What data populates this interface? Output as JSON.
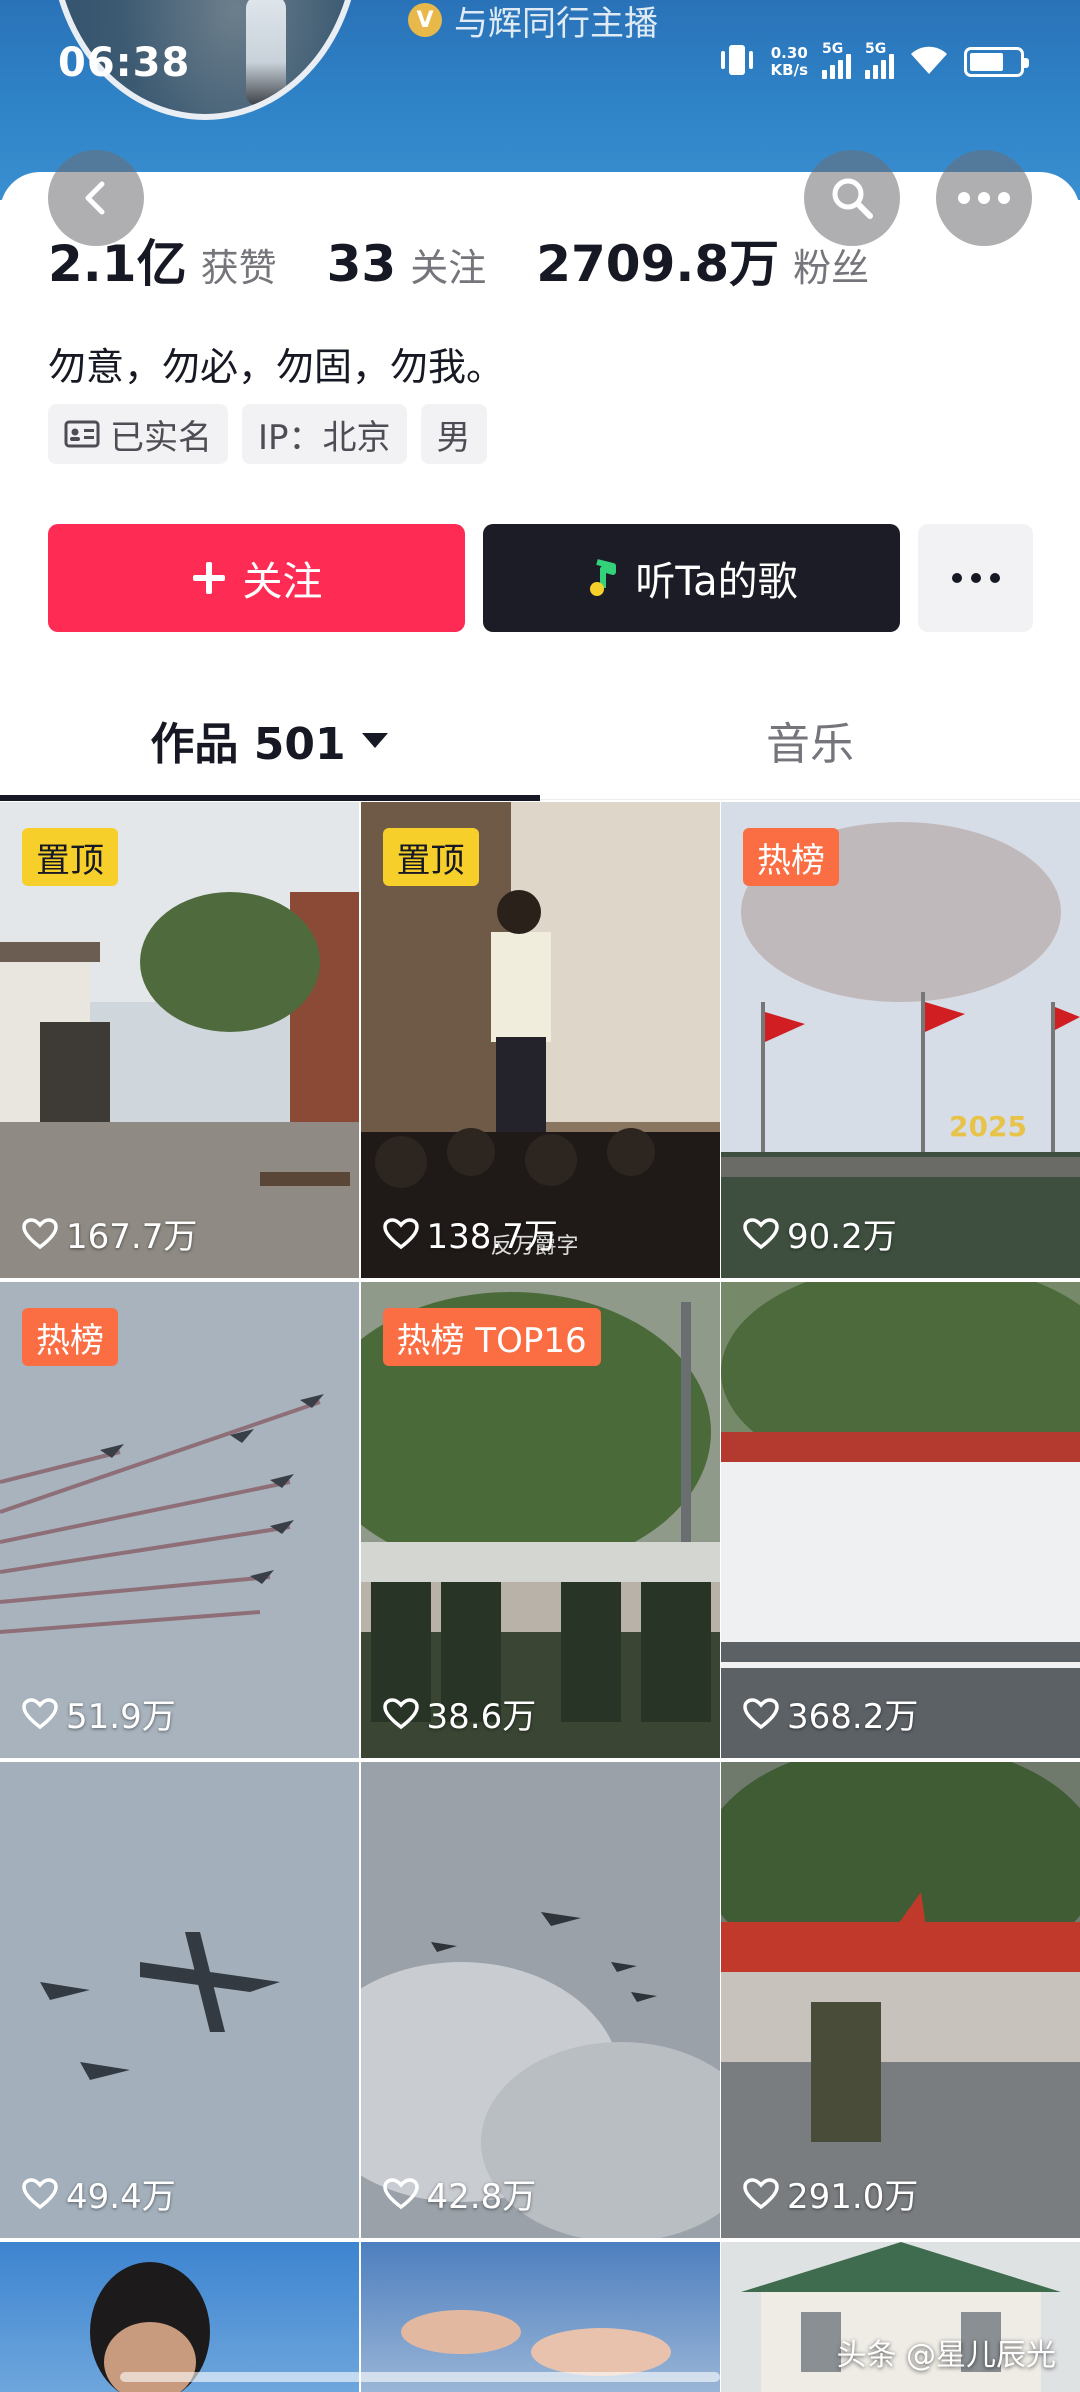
{
  "status_bar": {
    "time": "06:38",
    "speed_value": "0.30",
    "speed_unit": "KB/s",
    "signal_1": "5G",
    "signal_2": "5G"
  },
  "header": {
    "verified_badge": "V",
    "verified_text": "与辉同行主播"
  },
  "stats": {
    "likes_value": "2.1亿",
    "likes_label": "获赞",
    "following_value": "33",
    "following_label": "关注",
    "followers_value": "2709.8万",
    "followers_label": "粉丝"
  },
  "profile": {
    "bio": "勿意，勿必，勿固，勿我。",
    "tags": [
      "已实名",
      "IP：北京",
      "男"
    ]
  },
  "actions": {
    "follow_label": "关注",
    "music_label": "听Ta的歌"
  },
  "tabs": {
    "works_label": "作品 501",
    "music_label": "音乐"
  },
  "grid": [
    {
      "badge": "置顶",
      "likes": "167.7万"
    },
    {
      "badge": "置顶",
      "likes": "138.7万",
      "overlay_text": "反万爵字"
    },
    {
      "badge": "热榜",
      "likes": "90.2万",
      "overlay_text": "2025"
    },
    {
      "badge": "热榜",
      "likes": "51.9万"
    },
    {
      "badge": "热榜 TOP16",
      "likes": "38.6万"
    },
    {
      "badge": "",
      "likes": "368.2万"
    },
    {
      "badge": "",
      "likes": "49.4万"
    },
    {
      "badge": "",
      "likes": "42.8万"
    },
    {
      "badge": "",
      "likes": "291.0万"
    }
  ],
  "watermark": "头条 @星儿辰光",
  "colors": {
    "follow_red": "#fe2c55",
    "music_dark": "#1b1c25",
    "pin_yellow": "#f7cf2b",
    "hot_orange": "#fb6e44",
    "header_blue": "#2f84c8"
  }
}
